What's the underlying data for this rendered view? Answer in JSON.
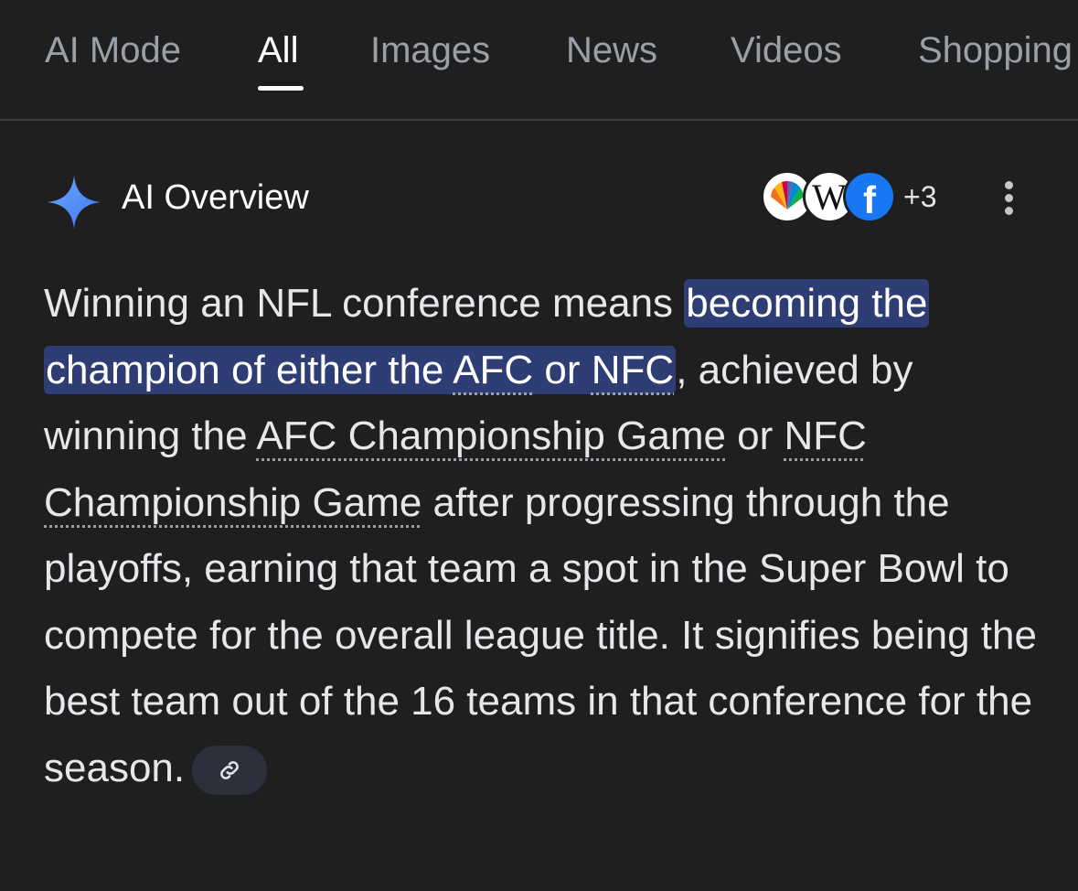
{
  "tabs": [
    {
      "label": "AI Mode"
    },
    {
      "label": "All"
    },
    {
      "label": "Images"
    },
    {
      "label": "News"
    },
    {
      "label": "Videos"
    },
    {
      "label": "Shopping"
    }
  ],
  "active_tab": "All",
  "ai_overview": {
    "title": "AI Overview",
    "sources": [
      {
        "icon": "nbc-peacock-icon"
      },
      {
        "icon": "wikipedia-w-icon",
        "letter": "W"
      },
      {
        "icon": "facebook-f-icon",
        "letter": "f"
      }
    ],
    "more_sources": "+3",
    "answer": {
      "p1": "Winning an NFL conference means ",
      "highlight1": "becoming the champion of either the ",
      "term_afc": "AFC",
      "hl_or": " or ",
      "term_nfc": "NFC",
      "p2": ", achieved by winning the ",
      "term_afc_game": "AFC Championship Game",
      "p3": " or ",
      "term_nfc_game": "NFC Championship Game",
      "p4": " after progressing through the playoffs, earning that team a spot in the Super Bowl to compete for the overall league title. It signifies being the best team out of the 16 teams in that conference for the season."
    }
  },
  "colors": {
    "background": "#1f1f1f",
    "highlight": "#2f3d75",
    "sparkle": "#4f8df7",
    "facebook": "#1877f2"
  }
}
